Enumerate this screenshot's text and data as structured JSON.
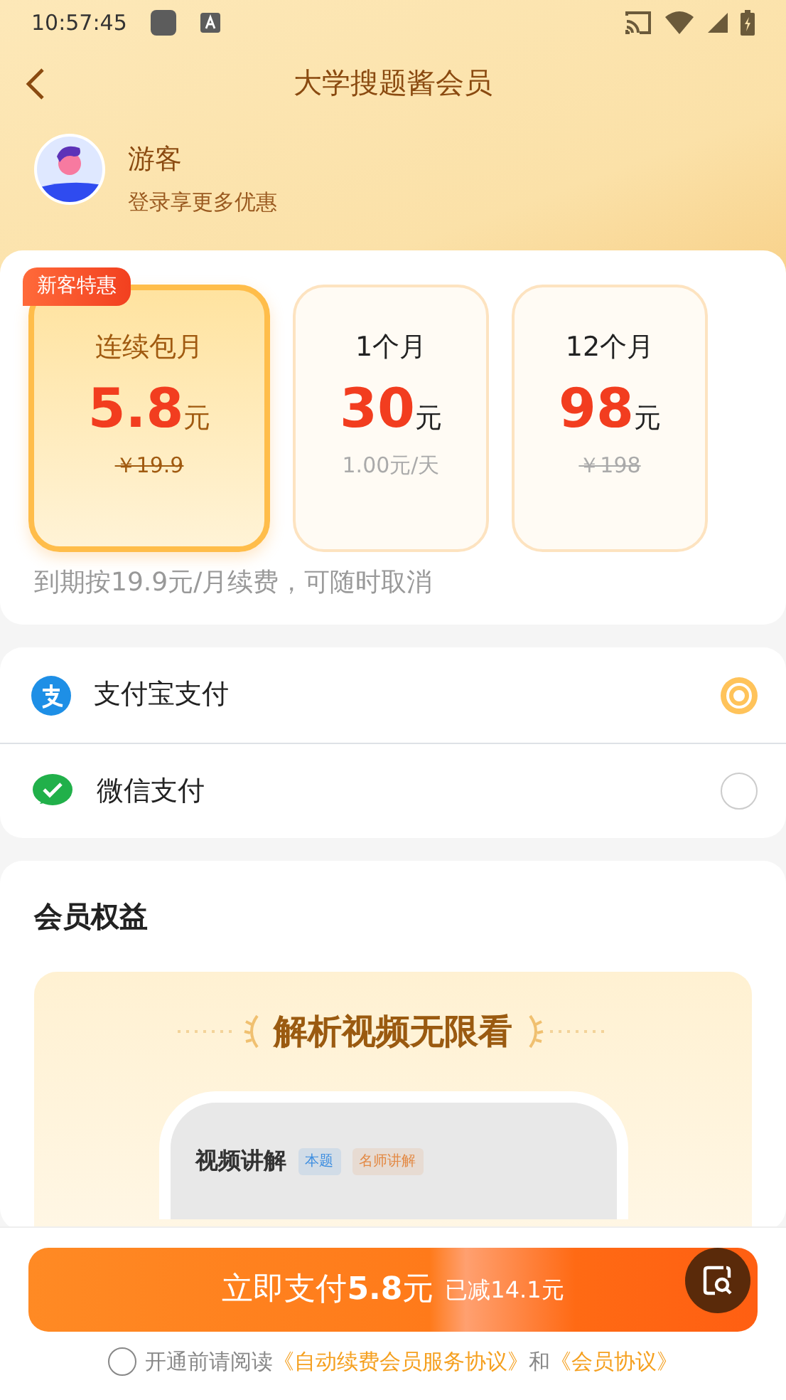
{
  "status_bar": {
    "time": "10:57:45"
  },
  "header": {
    "title": "大学搜题酱会员"
  },
  "user": {
    "name": "游客",
    "subtitle": "登录享更多优惠"
  },
  "plans": [
    {
      "name": "连续包月",
      "price": "5.8",
      "unit": "元",
      "note": "￥19.9",
      "struck": true,
      "badge": "新客特惠",
      "selected": true
    },
    {
      "name": "1个月",
      "price": "30",
      "unit": "元",
      "note": "1.00元/天",
      "struck": false,
      "selected": false
    },
    {
      "name": "12个月",
      "price": "98",
      "unit": "元",
      "note": "￥198",
      "struck": true,
      "selected": false
    }
  ],
  "renewal_note": "到期按19.9元/月续费，可随时取消",
  "payment_methods": [
    {
      "name": "支付宝支付",
      "kind": "alipay",
      "selected": true
    },
    {
      "name": "微信支付",
      "kind": "wechat",
      "selected": false
    }
  ],
  "benefits": {
    "title": "会员权益",
    "banner_title": "解析视频无限看",
    "preview": {
      "heading": "视频讲解",
      "tags": [
        {
          "label": "本题",
          "color": "#3d8ee0"
        },
        {
          "label": "名师讲解",
          "color": "#e38a45"
        }
      ]
    }
  },
  "pay_button": {
    "label": "立即支付**5.8**元",
    "discount": "已减14.1元"
  },
  "agreement": {
    "checked": false,
    "parts": [
      {
        "kind": "text",
        "text": "开通前请阅读"
      },
      {
        "kind": "link",
        "text": "《自动续费会员服务协议》"
      },
      {
        "kind": "text",
        "text": "和"
      },
      {
        "kind": "link",
        "text": "《会员协议》"
      }
    ]
  }
}
